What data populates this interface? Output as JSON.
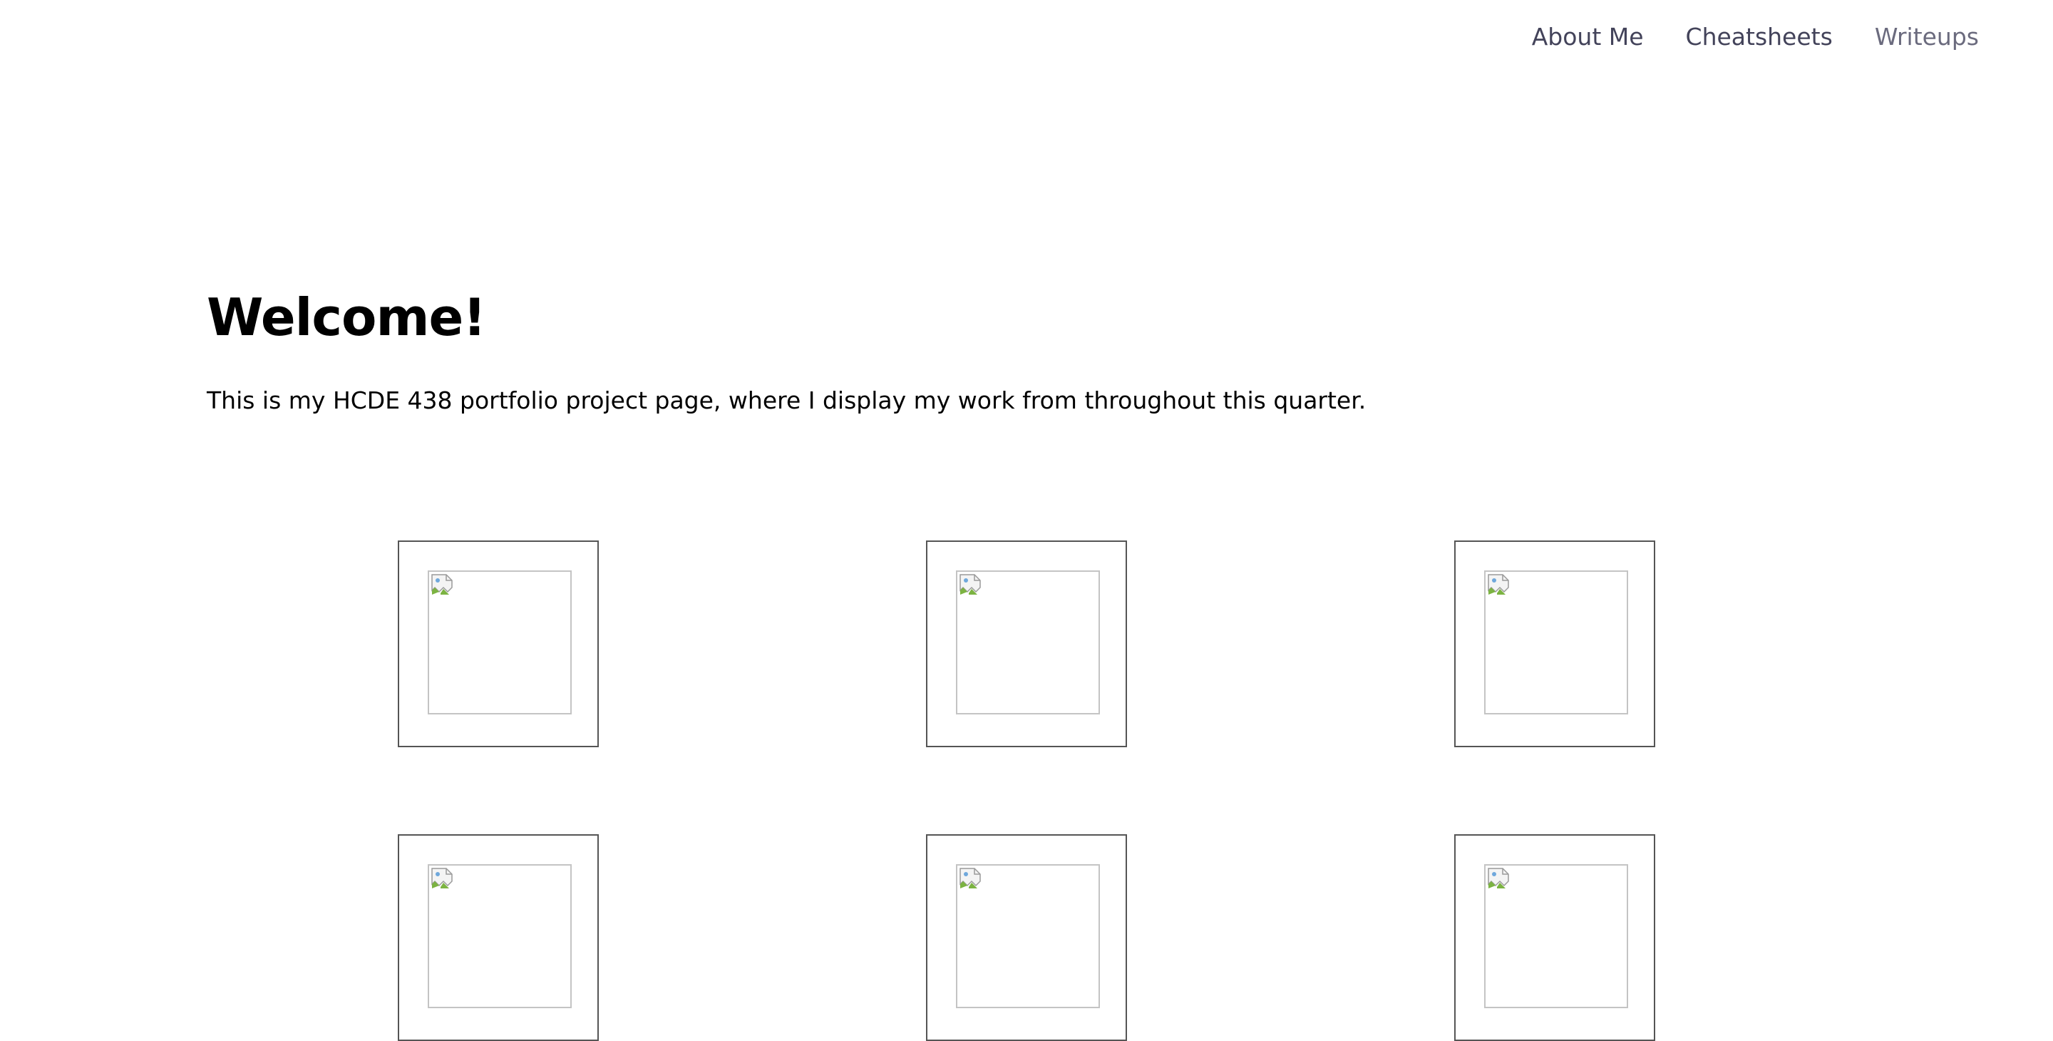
{
  "nav": {
    "items": [
      {
        "label": "About Me"
      },
      {
        "label": "Cheatsheets"
      },
      {
        "label": "Writeups"
      }
    ]
  },
  "hero": {
    "title": "Welcome!",
    "intro": "This is my HCDE 438 portfolio project page, where I display my work from throughout this quarter."
  },
  "gallery": {
    "tiles": [
      {
        "icon": "broken-image-icon"
      },
      {
        "icon": "broken-image-icon"
      },
      {
        "icon": "broken-image-icon"
      },
      {
        "icon": "broken-image-icon"
      },
      {
        "icon": "broken-image-icon"
      },
      {
        "icon": "broken-image-icon"
      }
    ]
  },
  "colors": {
    "nav_text": "#43435a",
    "nav_text_muted": "#6b6b7e",
    "tile_border": "#555555",
    "image_border": "#c4c4c4"
  }
}
